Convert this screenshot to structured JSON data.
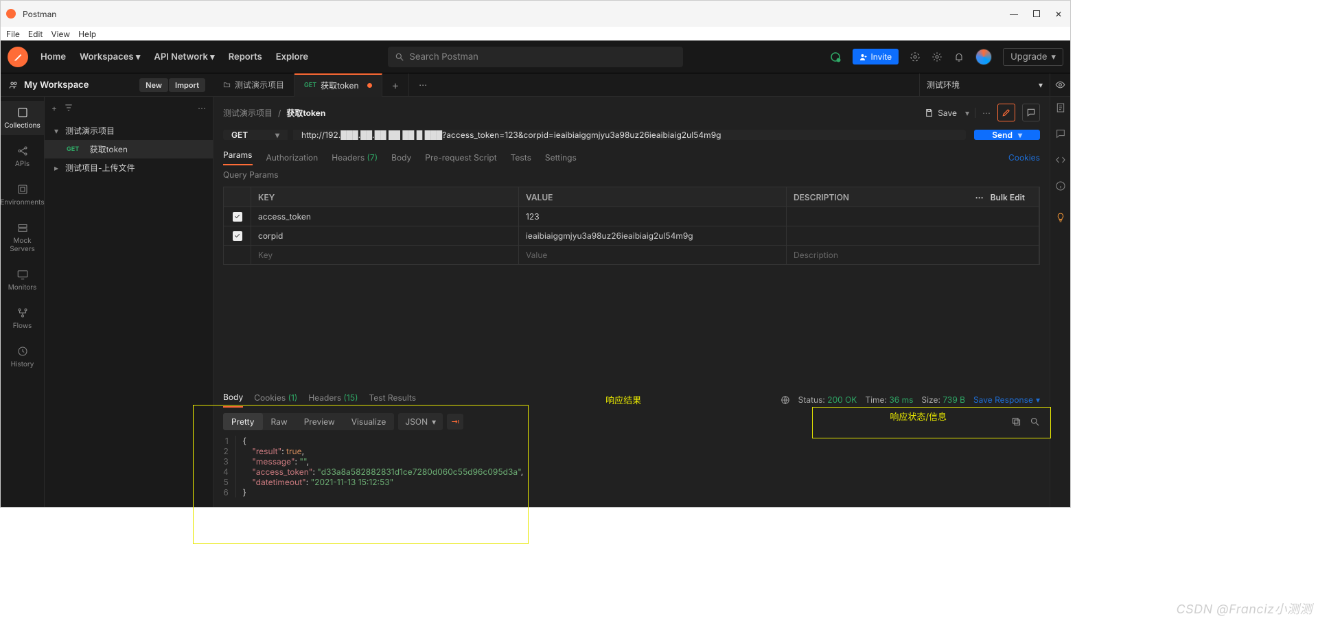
{
  "window": {
    "title": "Postman",
    "menu": [
      "File",
      "Edit",
      "View",
      "Help"
    ]
  },
  "topbar": {
    "nav": {
      "home": "Home",
      "workspaces": "Workspaces",
      "apinet": "API Network",
      "reports": "Reports",
      "explore": "Explore"
    },
    "search_placeholder": "Search Postman",
    "invite": "Invite",
    "upgrade": "Upgrade"
  },
  "workspace": {
    "name": "My Workspace",
    "new": "New",
    "import": "Import",
    "env": "测试环境"
  },
  "tabs": {
    "t0": "测试演示项目",
    "t1": "获取token",
    "t1_method": "GET"
  },
  "rail": {
    "collections": "Collections",
    "apis": "APIs",
    "env": "Environments",
    "mock": "Mock Servers",
    "monitors": "Monitors",
    "flows": "Flows",
    "history": "History"
  },
  "tree": {
    "proj": "测试演示项目",
    "getToken": "获取token",
    "getToken_m": "GET",
    "upload": "测试项目-上传文件"
  },
  "crumbs": {
    "parent": "测试演示项目",
    "sep": "/",
    "current": "获取token",
    "save": "Save"
  },
  "request": {
    "method": "GET",
    "url": "http://192.███.██.██ ██ ██ █ ███?access_token=123&corpid=ieaibiaiggmjyu3a98uz26ieaibiaig2ul54m9g",
    "send": "Send"
  },
  "reqtabs": {
    "params": "Params",
    "auth": "Authorization",
    "headers": "Headers",
    "headers_count": "(7)",
    "body": "Body",
    "prereq": "Pre-request Script",
    "tests": "Tests",
    "settings": "Settings",
    "cookies": "Cookies"
  },
  "qparams": {
    "heading": "Query Params",
    "hdr": {
      "key": "KEY",
      "value": "VALUE",
      "desc": "DESCRIPTION",
      "bulk": "Bulk Edit"
    },
    "rows": [
      {
        "key": "access_token",
        "value": "123"
      },
      {
        "key": "corpid",
        "value": "ieaibiaiggmjyu3a98uz26ieaibiaig2ul54m9g"
      }
    ],
    "ph": {
      "key": "Key",
      "value": "Value",
      "desc": "Description"
    }
  },
  "response": {
    "tabs": {
      "body": "Body",
      "cookies": "Cookies",
      "cookies_n": "(1)",
      "headers": "Headers",
      "headers_n": "(15)",
      "tests": "Test Results"
    },
    "annotation1": "响应结果",
    "annotation2": "响应状态/信息",
    "status": {
      "label": "Status:",
      "value": "200 OK",
      "timeL": "Time:",
      "time": "36 ms",
      "sizeL": "Size:",
      "size": "739 B",
      "save": "Save Response"
    },
    "view": {
      "pretty": "Pretty",
      "raw": "Raw",
      "preview": "Preview",
      "vis": "Visualize",
      "fmt": "JSON"
    },
    "json": {
      "l1": "{",
      "l2a": "\"result\"",
      "l2b": ": ",
      "l2c": "true",
      "l2d": ",",
      "l3a": "\"message\"",
      "l3b": ": ",
      "l3c": "\"\"",
      "l3d": ",",
      "l4a": "\"access_token\"",
      "l4b": ": ",
      "l4c": "\"d33a8a582882831d1ce7280d060c55d96c095d3a\"",
      "l4d": ",",
      "l5a": "\"datetimeout\"",
      "l5b": ": ",
      "l5c": "\"2021-11-13 15:12:53\"",
      "l6": "}"
    }
  },
  "watermark": "CSDN @Franciz小测测"
}
